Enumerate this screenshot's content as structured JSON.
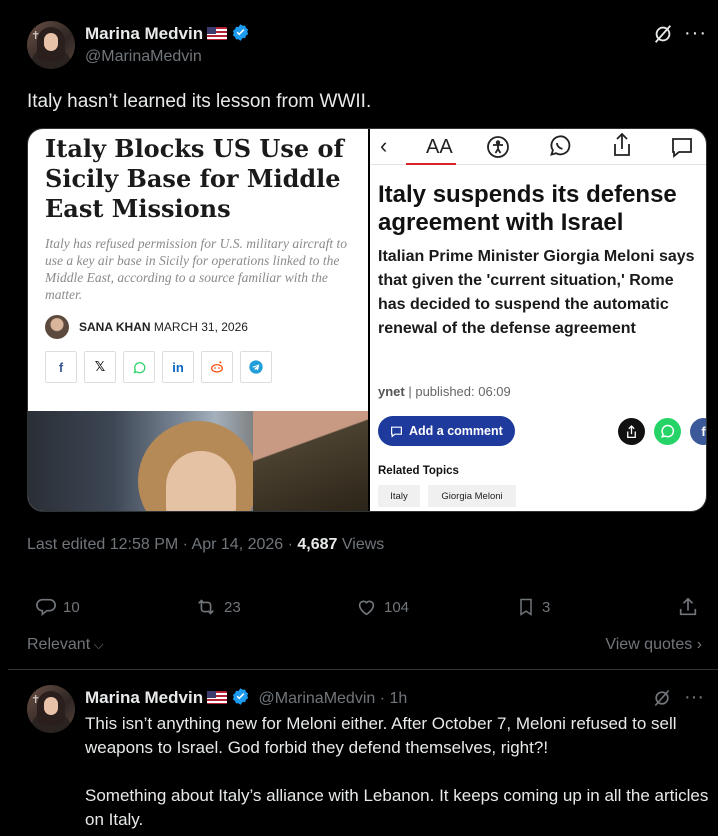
{
  "tweet": {
    "author_name": "Marina Medvin",
    "author_handle": "@MarinaMedvin",
    "text": "Italy hasn’t learned its lesson from WWII.",
    "meta": {
      "edited": "Last edited 12:58 PM · Apr 14, 2026 · ",
      "views_count": "4,687",
      "views_label": " Views"
    },
    "stats": {
      "replies": "10",
      "reposts": "23",
      "likes": "104",
      "bookmarks": "3"
    }
  },
  "left_article": {
    "title": "Italy Blocks US Use of Sicily Base for Middle East Missions",
    "subtitle": "Italy has refused permission for U.S. military aircraft to use a key air base in Sicily for operations linked to the Middle East, according to a source familiar with the matter.",
    "author": "SANA KHAN",
    "date": "MARCH 31, 2026",
    "share_icons": [
      "facebook-icon",
      "x-icon",
      "whatsapp-icon",
      "linkedin-icon",
      "reddit-icon",
      "telegram-icon"
    ]
  },
  "right_article": {
    "nav_text_size": "AA",
    "title": "Italy suspends its defense agreement with Israel",
    "body": "Italian Prime Minister Giorgia Meloni says that given the 'current situation,' Rome has decided to suspend the automatic renewal of the defense agreement",
    "source": "ynet",
    "published": "| published: 06:09",
    "comment_button": "Add a comment",
    "related_heading": "Related Topics",
    "related_chips": [
      "Italy",
      "Giorgia Meloni"
    ]
  },
  "replies_bar": {
    "sort_label": "Relevant",
    "view_quotes": "View quotes"
  },
  "reply": {
    "author_name": "Marina Medvin",
    "author_handle": "@MarinaMedvin",
    "time": "· 1h",
    "paragraph_1": "This isn’t anything new for Meloni either. After October 7, Meloni refused to sell weapons to Israel. God forbid they defend themselves, right?!",
    "paragraph_2": "Something about Italy’s alliance with Lebanon. It keeps coming up in all the articles on Italy."
  },
  "colors": {
    "background": "#000000",
    "text_primary": "#e7e9ea",
    "text_secondary": "#71767b",
    "verified_blue": "#1d9bf0",
    "ynet_red": "#d8232a",
    "ynet_button": "#1d3a9c"
  }
}
